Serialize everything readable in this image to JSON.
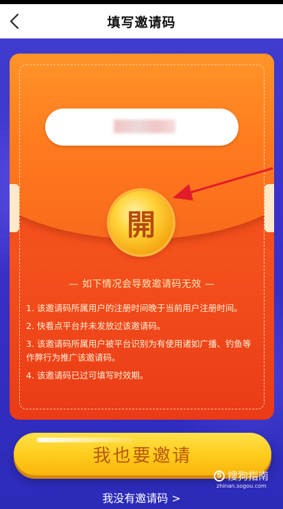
{
  "header": {
    "title": "填写邀请码"
  },
  "envelope": {
    "code_placeholder": "",
    "coin_char": "開",
    "notice_title": "— 如下情况会导致邀请码无效 —",
    "rules": [
      "1. 该邀请码所属用户的注册时间晚于当前用户注册时间。",
      "2. 快看点平台并未发放过该邀请码。",
      "3. 该邀请码所属用户被平台识别为有使用诸如广播、钓鱼等作弊行为推广该邀请码。",
      "4. 该邀请码已过可填写时效期。"
    ]
  },
  "actions": {
    "invite_label": "我也要邀请",
    "no_code_label": "我没有邀请码 >"
  },
  "watermark": {
    "main": "搜狗指南",
    "sub": "zhinan.sogou.com"
  },
  "icons": {
    "back": "back-chevron-icon",
    "arrow": "annotation-arrow-icon",
    "watermark": "sogou-logo-icon"
  },
  "colors": {
    "envelope": "#f4511d",
    "flap": "#ff8a24",
    "coin": "#ffd43a",
    "button": "#ffcb1a",
    "background": "#3b2fc7"
  }
}
